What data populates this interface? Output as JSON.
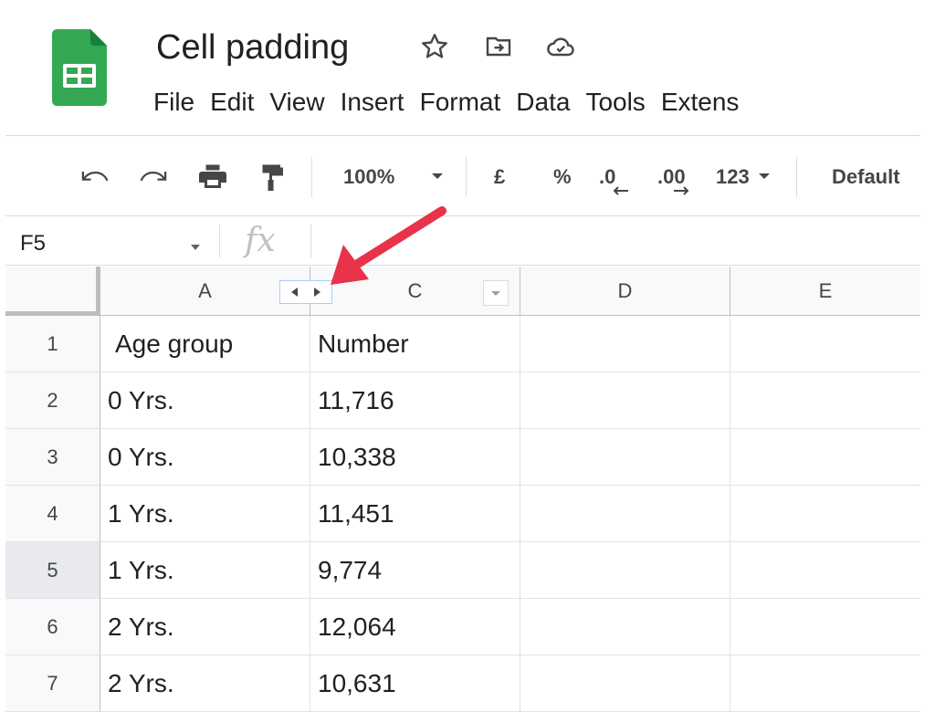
{
  "app": {
    "doc_title": "Cell padding",
    "icons": {
      "logo": "sheets-logo-icon",
      "star": "star-icon",
      "move": "move-to-folder-icon",
      "cloud": "cloud-status-icon"
    }
  },
  "menu": [
    "File",
    "Edit",
    "View",
    "Insert",
    "Format",
    "Data",
    "Tools",
    "Extens"
  ],
  "toolbar": {
    "zoom": "100%",
    "currency": "£",
    "percent": "%",
    "decrease_decimal": ".0",
    "increase_decimal": ".00",
    "number_format": "123",
    "font": "Default",
    "icons": [
      "undo-icon",
      "redo-icon",
      "print-icon",
      "paint-format-icon"
    ]
  },
  "formula_bar": {
    "name_box": "F5",
    "fx": "fx",
    "content": ""
  },
  "grid": {
    "columns": [
      "A",
      "C",
      "D",
      "E"
    ],
    "rows": [
      {
        "num": "1",
        "a": "Age group",
        "c": "Number"
      },
      {
        "num": "2",
        "a": "0 Yrs.",
        "c": "11,716"
      },
      {
        "num": "3",
        "a": "0 Yrs.",
        "c": "10,338"
      },
      {
        "num": "4",
        "a": "1 Yrs.",
        "c": "11,451"
      },
      {
        "num": "5",
        "a": "1 Yrs.",
        "c": "9,774"
      },
      {
        "num": "6",
        "a": "2 Yrs.",
        "c": "12,064"
      },
      {
        "num": "7",
        "a": "2 Yrs.",
        "c": "10,631"
      }
    ],
    "selected_row": "5",
    "hidden_column_marker": "unhide-column-b-arrows",
    "annotation_color": "#e8334a"
  }
}
